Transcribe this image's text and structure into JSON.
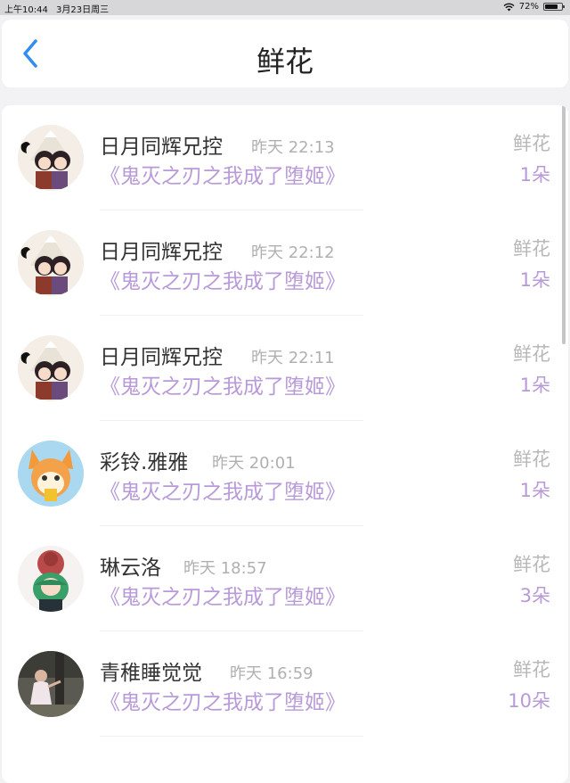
{
  "status_bar": {
    "time": "上午10:44",
    "date": "3月23日周三",
    "battery": "72%"
  },
  "header": {
    "title": "鲜花"
  },
  "colors": {
    "accent_blue": "#2f8ef0",
    "purple_text": "#b89ad8",
    "gray_text": "#b0b0b0"
  },
  "records": [
    {
      "user": "日月同辉兄控",
      "time": "昨天 22:13",
      "book": "《鬼灭之刃之我成了堕姬》",
      "gift": "鲜花",
      "count": "1朵",
      "avatar": "anime-couple-avatar"
    },
    {
      "user": "日月同辉兄控",
      "time": "昨天 22:12",
      "book": "《鬼灭之刃之我成了堕姬》",
      "gift": "鲜花",
      "count": "1朵",
      "avatar": "anime-couple-avatar"
    },
    {
      "user": "日月同辉兄控",
      "time": "昨天 22:11",
      "book": "《鬼灭之刃之我成了堕姬》",
      "gift": "鲜花",
      "count": "1朵",
      "avatar": "anime-couple-avatar"
    },
    {
      "user": "彩铃.雅雅",
      "time": "昨天 20:01",
      "book": "《鬼灭之刃之我成了堕姬》",
      "gift": "鲜花",
      "count": "1朵",
      "avatar": "fox-character-avatar"
    },
    {
      "user": "琳云洛",
      "time": "昨天 18:57",
      "book": "《鬼灭之刃之我成了堕姬》",
      "gift": "鲜花",
      "count": "3朵",
      "avatar": "red-green-hair-avatar"
    },
    {
      "user": "青稚睡觉觉",
      "time": "昨天 16:59",
      "book": "《鬼灭之刃之我成了堕姬》",
      "gift": "鲜花",
      "count": "10朵",
      "avatar": "photo-avatar"
    }
  ]
}
